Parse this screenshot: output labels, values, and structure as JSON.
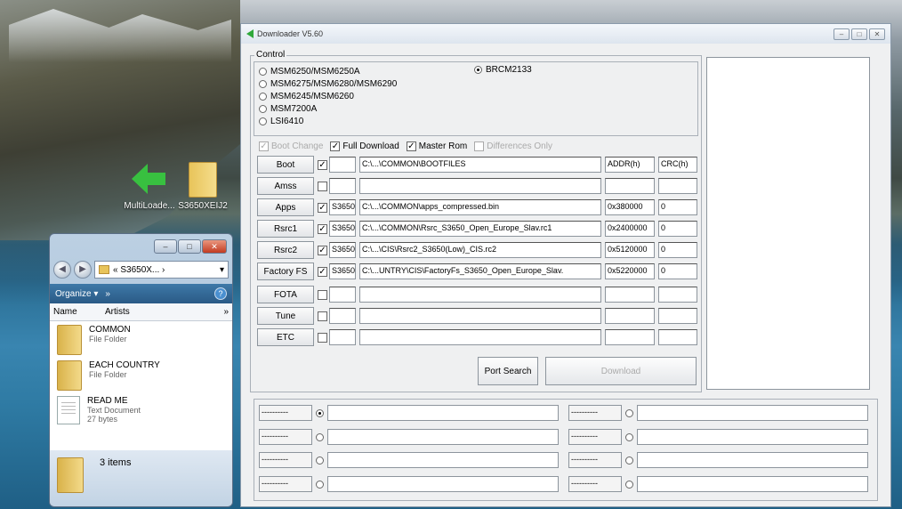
{
  "desktop": {
    "icons": [
      {
        "label": "MultiLoade..."
      },
      {
        "label": "S3650XEIJ2"
      }
    ]
  },
  "explorer": {
    "address": "« S3650X... ›",
    "toolbar": {
      "organize": "Organize ▾",
      "more": "»"
    },
    "columns": [
      "Name",
      "Artists"
    ],
    "items": [
      {
        "name": "COMMON",
        "type": "File Folder",
        "size": ""
      },
      {
        "name": "EACH COUNTRY",
        "type": "File Folder",
        "size": ""
      },
      {
        "name": "READ ME",
        "type": "Text Document",
        "size": "27 bytes"
      }
    ],
    "status": "3 items"
  },
  "downloader": {
    "title": "Downloader V5.60",
    "control_label": "Control",
    "chipsets": [
      {
        "label": "MSM6250/MSM6250A",
        "selected": false
      },
      {
        "label": "MSM6275/MSM6280/MSM6290",
        "selected": false
      },
      {
        "label": "MSM6245/MSM6260",
        "selected": false
      },
      {
        "label": "MSM7200A",
        "selected": false
      },
      {
        "label": "LSI6410",
        "selected": false
      },
      {
        "label": "BRCM2133",
        "selected": true
      }
    ],
    "options": {
      "boot_change": "Boot Change",
      "full_download": "Full Download",
      "master_rom": "Master Rom",
      "differences_only": "Differences Only"
    },
    "rows": [
      {
        "label": "Boot",
        "checked": true,
        "version": "",
        "path": "C:\\...\\COMMON\\BOOTFILES",
        "addr": "ADDR(h)",
        "crc": "CRC(h)"
      },
      {
        "label": "Amss",
        "checked": false,
        "version": "",
        "path": "",
        "addr": "",
        "crc": ""
      },
      {
        "label": "Apps",
        "checked": true,
        "version": "S3650",
        "path": "C:\\...\\COMMON\\apps_compressed.bin",
        "addr": "0x380000",
        "crc": "0"
      },
      {
        "label": "Rsrc1",
        "checked": true,
        "version": "S3650",
        "path": "C:\\...\\COMMON\\Rsrc_S3650_Open_Europe_Slav.rc1",
        "addr": "0x2400000",
        "crc": "0"
      },
      {
        "label": "Rsrc2",
        "checked": true,
        "version": "S3650",
        "path": "C:\\...\\CIS\\Rsrc2_S3650(Low)_CIS.rc2",
        "addr": "0x5120000",
        "crc": "0"
      },
      {
        "label": "Factory FS",
        "checked": true,
        "version": "S3650",
        "path": "C:\\...UNTRY\\CIS\\FactoryFs_S3650_Open_Europe_Slav.",
        "addr": "0x5220000",
        "crc": "0"
      },
      {
        "label": "FOTA",
        "checked": false,
        "version": "",
        "path": "",
        "addr": "",
        "crc": ""
      },
      {
        "label": "Tune",
        "checked": false,
        "version": "",
        "path": "",
        "addr": "",
        "crc": ""
      },
      {
        "label": "ETC",
        "checked": false,
        "version": "",
        "path": "",
        "addr": "",
        "crc": ""
      }
    ],
    "port_search": "Port Search",
    "download": "Download",
    "ports": [
      {
        "label": "----------",
        "selected": true
      },
      {
        "label": "----------",
        "selected": false
      },
      {
        "label": "----------",
        "selected": false
      },
      {
        "label": "----------",
        "selected": false
      },
      {
        "label": "----------",
        "selected": false
      },
      {
        "label": "----------",
        "selected": false
      },
      {
        "label": "----------",
        "selected": false
      },
      {
        "label": "----------",
        "selected": false
      }
    ]
  }
}
